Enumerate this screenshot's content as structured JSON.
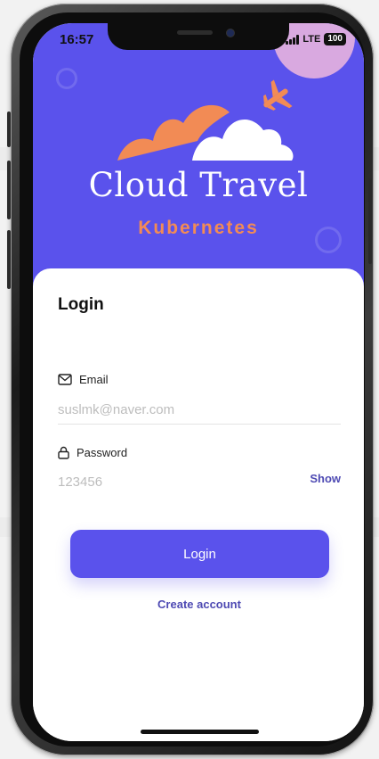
{
  "status": {
    "time": "16:57",
    "network": "LTE",
    "battery": "100"
  },
  "brand": {
    "title": "Cloud Travel",
    "subtitle": "Kubernetes"
  },
  "colors": {
    "primary": "#5a52ec",
    "accent": "#f28b55",
    "link": "#4e4ab3"
  },
  "login": {
    "heading": "Login",
    "email_label": "Email",
    "email_placeholder": "suslmk@naver.com",
    "password_label": "Password",
    "password_placeholder": "123456",
    "show_label": "Show",
    "submit_label": "Login",
    "create_account_label": "Create account"
  },
  "icons": {
    "email": "envelope-icon",
    "password": "lock-icon",
    "logo": "cloud-airplane-logo"
  }
}
